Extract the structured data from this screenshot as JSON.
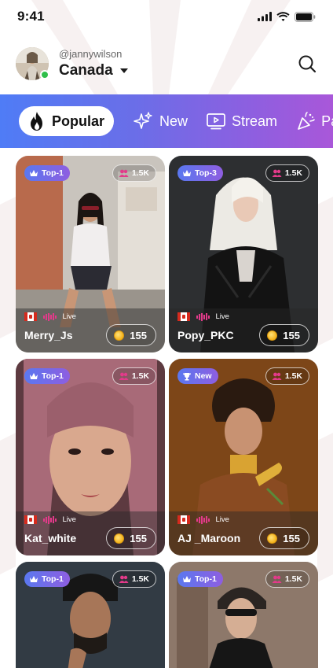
{
  "status_bar": {
    "time": "9:41"
  },
  "header": {
    "handle": "@jannywilson",
    "country": "Canada"
  },
  "tabs": [
    {
      "label": "Popular",
      "icon": "fire-icon",
      "active": true
    },
    {
      "label": "New",
      "icon": "sparkle-icon",
      "active": false
    },
    {
      "label": "Stream",
      "icon": "stream-icon",
      "active": false
    },
    {
      "label": "Pa",
      "icon": "party-popper-icon",
      "active": false
    }
  ],
  "colors": {
    "accent_start": "#4f7cf6",
    "accent_end": "#a957d9",
    "online": "#2fbf4a",
    "live_bars": "#e33a8a",
    "coin": "#f4b21a"
  },
  "cards": [
    {
      "badge": "Top-1",
      "badge_icon": "crown-icon",
      "viewers": "1.5K",
      "live": "Live",
      "name": "Merry_Js",
      "coins": "155"
    },
    {
      "badge": "Top-3",
      "badge_icon": "crown-icon",
      "viewers": "1.5K",
      "live": "Live",
      "name": "Popy_PKC",
      "coins": "155"
    },
    {
      "badge": "Top-1",
      "badge_icon": "crown-icon",
      "viewers": "1.5K",
      "live": "Live",
      "name": "Kat_white",
      "coins": "155"
    },
    {
      "badge": "New",
      "badge_icon": "trophy-icon",
      "viewers": "1.5K",
      "live": "Live",
      "name": "AJ _Maroon",
      "coins": "155"
    },
    {
      "badge": "Top-1",
      "badge_icon": "crown-icon",
      "viewers": "1.5K"
    },
    {
      "badge": "Top-1",
      "badge_icon": "crown-icon",
      "viewers": "1.5K"
    }
  ]
}
